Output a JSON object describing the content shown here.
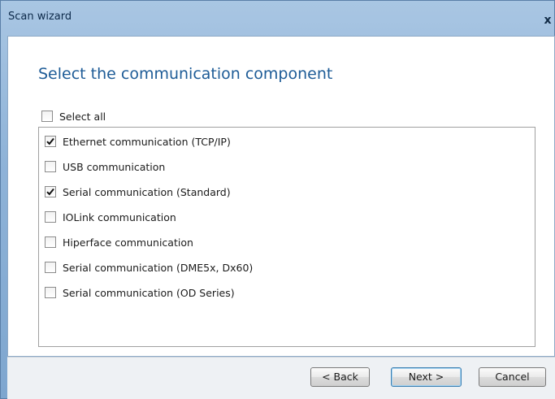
{
  "window": {
    "title": "Scan wizard",
    "close_label": "x"
  },
  "heading": "Select the communication component",
  "select_all": {
    "label": "Select all",
    "checked": false
  },
  "components": [
    {
      "label": "Ethernet communication (TCP/IP)",
      "checked": true
    },
    {
      "label": "USB communication",
      "checked": false
    },
    {
      "label": "Serial communication (Standard)",
      "checked": true
    },
    {
      "label": "IOLink communication",
      "checked": false
    },
    {
      "label": "Hiperface communication",
      "checked": false
    },
    {
      "label": "Serial communication (DME5x, Dx60)",
      "checked": false
    },
    {
      "label": "Serial communication (OD Series)",
      "checked": false
    }
  ],
  "buttons": {
    "back": "< Back",
    "next": "Next >",
    "cancel": "Cancel"
  },
  "colors": {
    "heading": "#1e5c97",
    "title_bar": "#8fb3d8"
  }
}
